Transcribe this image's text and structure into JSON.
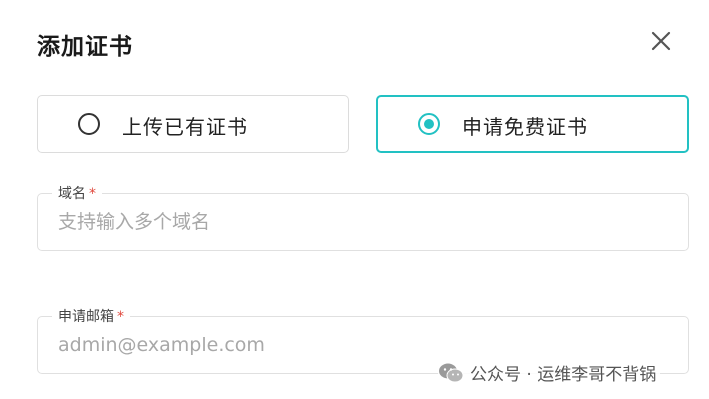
{
  "dialog": {
    "title": "添加证书"
  },
  "cert_options": [
    {
      "label": "上传已有证书",
      "selected": false
    },
    {
      "label": "申请免费证书",
      "selected": true
    }
  ],
  "fields": {
    "domain": {
      "label": "域名",
      "required_mark": "*",
      "placeholder": "支持输入多个域名",
      "value": ""
    },
    "email": {
      "label": "申请邮箱",
      "required_mark": "*",
      "placeholder": "admin@example.com",
      "value": ""
    }
  },
  "watermark": {
    "text": "公众号 · 运维李哥不背锅",
    "icon": "wechat-icon"
  },
  "colors": {
    "accent": "#22c1c3",
    "required": "#e0483d"
  }
}
